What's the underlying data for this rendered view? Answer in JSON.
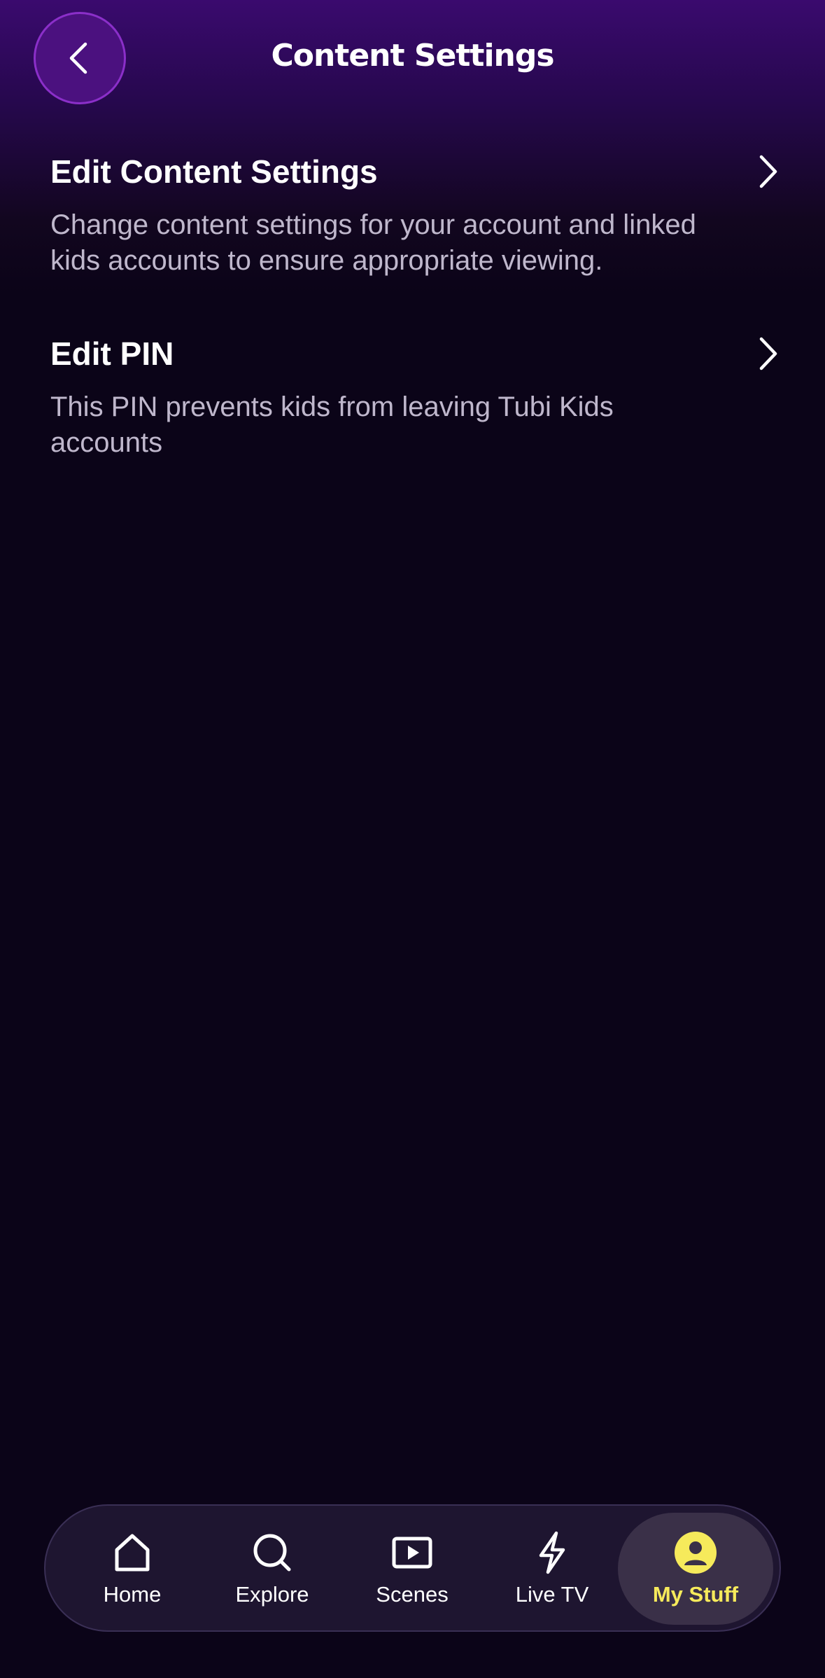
{
  "header": {
    "title": "Content Settings",
    "back_icon": "chevron-left-icon"
  },
  "settings": [
    {
      "title": "Edit Content Settings",
      "description": "Change content settings for your account and linked kids accounts to ensure appropriate viewing.",
      "icon": "chevron-right-icon"
    },
    {
      "title": "Edit PIN",
      "description": "This PIN prevents kids from leaving Tubi Kids accounts",
      "icon": "chevron-right-icon"
    }
  ],
  "tabbar": {
    "items": [
      {
        "label": "Home",
        "icon": "home-icon"
      },
      {
        "label": "Explore",
        "icon": "search-icon"
      },
      {
        "label": "Scenes",
        "icon": "play-icon"
      },
      {
        "label": "Live TV",
        "icon": "lightning-icon"
      },
      {
        "label": "My Stuff",
        "icon": "profile-icon"
      }
    ],
    "active": "My Stuff"
  },
  "colors": {
    "background": "#0b0418",
    "header_gradient_top": "#3a0a6e",
    "back_button_fill": "#4b117f",
    "back_button_border": "#8b2fc9",
    "active_tab_text": "#f6ea5b",
    "description_text": "#bfb7cc"
  }
}
